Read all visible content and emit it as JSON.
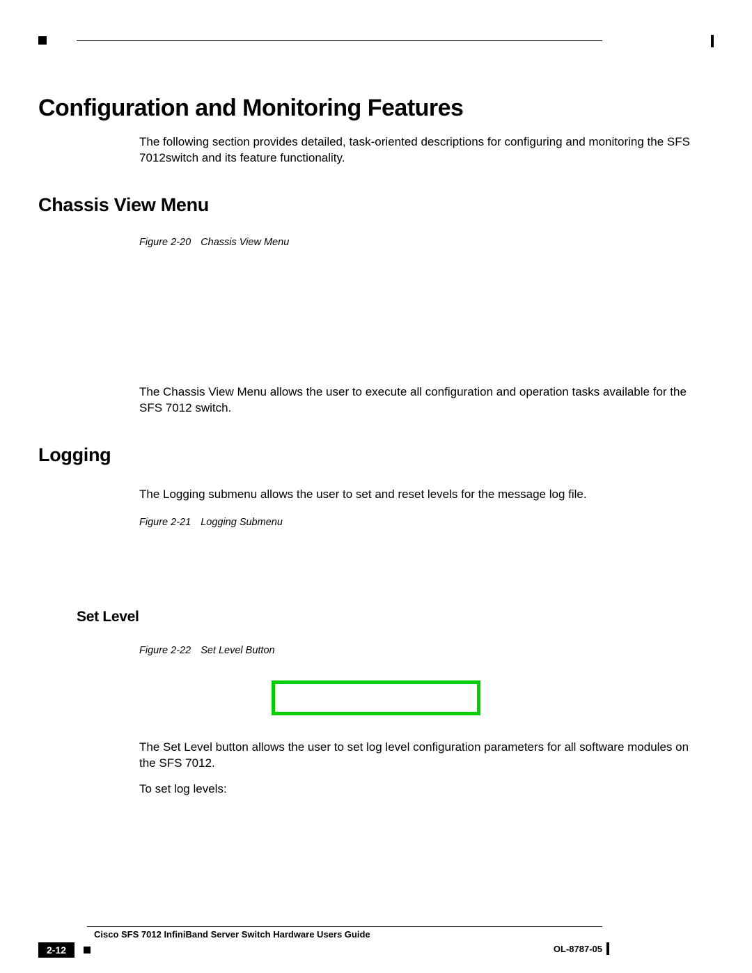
{
  "headings": {
    "h1": "Configuration and Monitoring Features",
    "h2_chassis": "Chassis View Menu",
    "h2_logging": "Logging",
    "h3_setlevel": "Set Level"
  },
  "paragraphs": {
    "intro": "The following section provides detailed, task-oriented descriptions for configuring and monitoring the SFS 7012switch and its feature functionality.",
    "chassis_desc": "The Chassis View Menu allows the user to execute all configuration and operation tasks available for the SFS 7012 switch.",
    "logging_desc": "The Logging submenu allows the user to set and reset levels for the message log file.",
    "setlevel_desc": "The Set Level button allows the user to set log level configuration parameters for all software modules on the SFS 7012.",
    "setlevel_lead": "To set log levels:"
  },
  "figures": {
    "f20_num": "Figure 2-20",
    "f20_title": "Chassis View Menu",
    "f21_num": "Figure 2-21",
    "f21_title": "Logging Submenu",
    "f22_num": "Figure 2-22",
    "f22_title": "Set Level Button"
  },
  "footer": {
    "doc_title": "Cisco SFS 7012 InfiniBand Server Switch Hardware Users Guide",
    "page_number": "2-12",
    "doc_id": "OL-8787-05"
  }
}
